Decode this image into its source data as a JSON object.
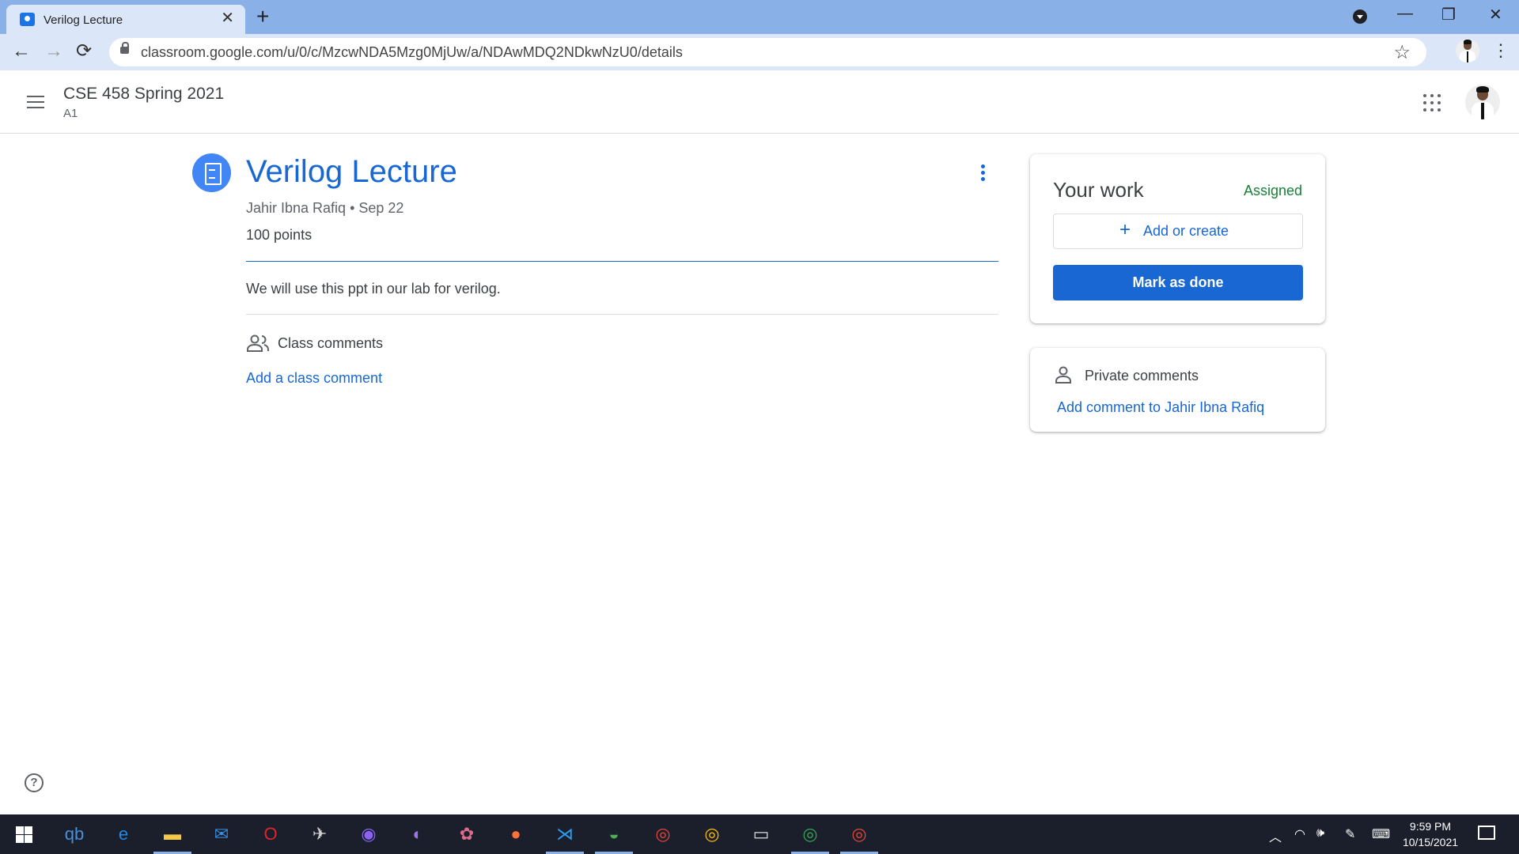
{
  "browser": {
    "tab_title": "Verilog Lecture",
    "tab_close": "✕",
    "new_tab": "+",
    "url": "classroom.google.com/u/0/c/MzcwNDA5Mzg0MjUw/a/NDAwMDQ2NDkwNzU0/details",
    "window_controls": {
      "minimize": "—",
      "restore": "❐",
      "close": "✕"
    },
    "nav": {
      "back": "←",
      "forward": "→",
      "reload": "⟳"
    },
    "bookmark": "☆",
    "menu": "⋮"
  },
  "header": {
    "course_title": "CSE 458 Spring 2021",
    "course_subtitle": "A1"
  },
  "assignment": {
    "title": "Verilog Lecture",
    "meta": "Jahir Ibna Rafiq • Sep 22",
    "points": "100 points",
    "description": "We will use this ppt in our lab for verilog.",
    "class_comments_label": "Class comments",
    "add_class_comment": "Add a class comment"
  },
  "your_work": {
    "title": "Your work",
    "status": "Assigned",
    "add_label": "Add or create",
    "add_plus": "+",
    "mark_done": "Mark as done"
  },
  "private_comments": {
    "label": "Private comments",
    "add_label": "Add comment to Jahir Ibna Rafiq"
  },
  "help": "?",
  "taskbar": {
    "apps": [
      {
        "name": "qbittorrent",
        "glyph": "qb",
        "color": "#4a8fd6"
      },
      {
        "name": "edge-legacy",
        "glyph": "e",
        "color": "#1f88e5"
      },
      {
        "name": "file-explorer",
        "glyph": "▬",
        "color": "#f2c94c"
      },
      {
        "name": "mail",
        "glyph": "✉",
        "color": "#3a8fe6"
      },
      {
        "name": "opera",
        "glyph": "O",
        "color": "#e0242b"
      },
      {
        "name": "satellite",
        "glyph": "✈",
        "color": "#cccccc"
      },
      {
        "name": "messenger",
        "glyph": "◉",
        "color": "#8a63f5"
      },
      {
        "name": "github",
        "glyph": "◐",
        "color": "#9f74e8"
      },
      {
        "name": "paint",
        "glyph": "✿",
        "color": "#dd6b8a"
      },
      {
        "name": "firefox",
        "glyph": "●",
        "color": "#ff7139"
      },
      {
        "name": "vscode",
        "glyph": "⋊",
        "color": "#2c9df2"
      },
      {
        "name": "weather",
        "glyph": "◒",
        "color": "#4caf50"
      },
      {
        "name": "chrome-1",
        "glyph": "◎",
        "color": "#e94235"
      },
      {
        "name": "chrome-2",
        "glyph": "◎",
        "color": "#fbbc05"
      },
      {
        "name": "terminal",
        "glyph": "▭",
        "color": "#dddddd"
      },
      {
        "name": "chrome-ek",
        "glyph": "◎",
        "color": "#34a853"
      },
      {
        "name": "chrome-active",
        "glyph": "◎",
        "color": "#ea4335"
      }
    ],
    "tray": {
      "chevron": "︿",
      "network": "◠",
      "volume": "🕪",
      "pen": "✎",
      "keyboard": "⌨"
    },
    "time": "9:59 PM",
    "date": "10/15/2021"
  }
}
